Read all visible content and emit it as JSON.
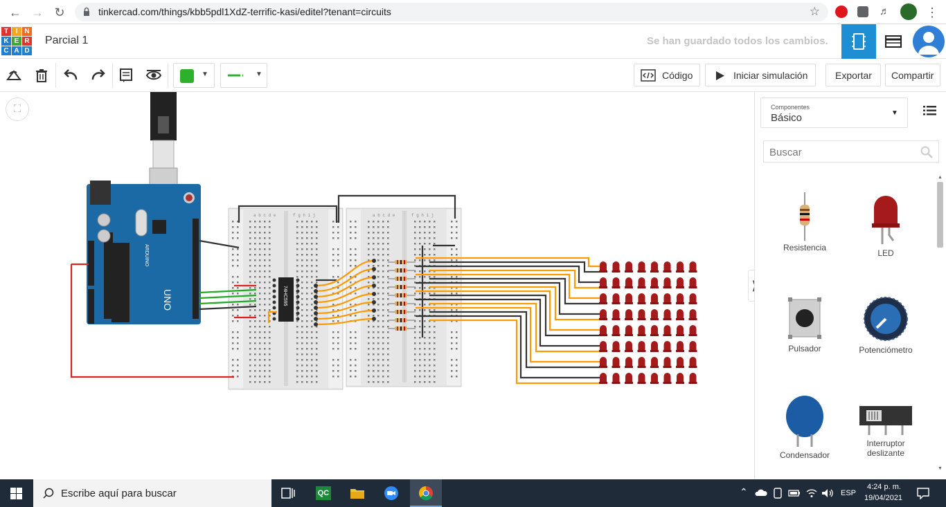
{
  "browser": {
    "url": "tinkercad.com/things/kbb5pdl1XdZ-terrific-kasi/editel?tenant=circuits"
  },
  "app": {
    "logo_letters": [
      "T",
      "I",
      "N",
      "K",
      "E",
      "R",
      "C",
      "A",
      "D"
    ],
    "project_name": "Parcial 1",
    "save_status": "Se han guardado todos los cambios."
  },
  "toolbar": {
    "code_label": "Código",
    "start_sim_label": "Iniciar simulación",
    "export_label": "Exportar",
    "share_label": "Compartir",
    "fill_color": "#2db12d",
    "wire_color": "#2db12d"
  },
  "canvas": {
    "chip_label": "74HC595",
    "board_label": "UNO",
    "board_brand": "ARDUINO",
    "breadboard_cols_left": "a b c d e",
    "breadboard_cols_right": "f g h i j"
  },
  "panel": {
    "components_small": "Componentes",
    "components_value": "Básico",
    "search_placeholder": "Buscar",
    "items": [
      {
        "label": "Resistencia",
        "icon": "resistor-icon"
      },
      {
        "label": "LED",
        "icon": "led-icon"
      },
      {
        "label": "Pulsador",
        "icon": "pushbutton-icon"
      },
      {
        "label": "Potenciómetro",
        "icon": "potentiometer-icon"
      },
      {
        "label": "Condensador",
        "icon": "capacitor-icon"
      },
      {
        "label": "Interruptor deslizante",
        "icon": "slide-switch-icon"
      }
    ]
  },
  "taskbar": {
    "search_placeholder": "Escribe aquí para buscar",
    "language": "ESP",
    "time": "4:24 p. m.",
    "date": "19/04/2021",
    "qc_label": "QC"
  }
}
